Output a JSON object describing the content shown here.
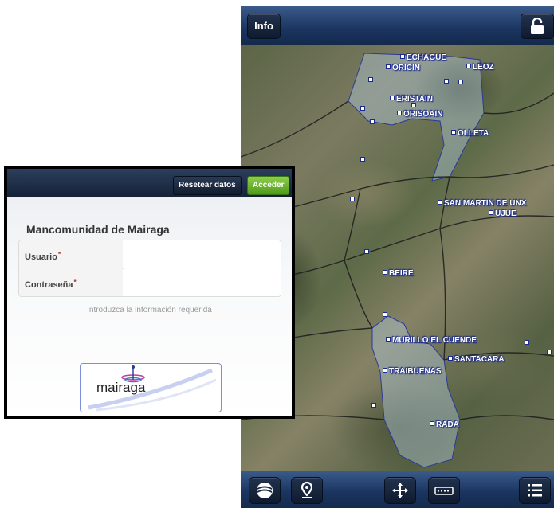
{
  "map_app": {
    "info_label": "Info",
    "lock_icon": "unlock-icon",
    "towns": [
      {
        "name": "ECHAGUE"
      },
      {
        "name": "ORICIN"
      },
      {
        "name": "LEOZ"
      },
      {
        "name": "ERISTAIN"
      },
      {
        "name": "ORISOAIN"
      },
      {
        "name": "OLLETA"
      },
      {
        "name": "SAN MARTIN DE UNX"
      },
      {
        "name": "UJUE"
      },
      {
        "name": "BEIRE"
      },
      {
        "name": "MURILLO EL CUENDE"
      },
      {
        "name": "SANTACARA"
      },
      {
        "name": "TRAIBUENAS"
      },
      {
        "name": "RADA"
      }
    ],
    "bottom_icons": [
      "layers-globe-icon",
      "location-pin-icon",
      "move-arrows-icon",
      "keyboard-icon",
      "list-menu-icon"
    ],
    "accent_color": "#1b3560",
    "label_outline_color": "#1a2a8a"
  },
  "login": {
    "reset_label": "Resetear datos",
    "access_label": "Acceder",
    "org_title": "Mancomunidad de Mairaga",
    "fields": [
      {
        "label": "Usuario",
        "required_mark": "*",
        "value": "",
        "placeholder": ""
      },
      {
        "label": "Contraseña",
        "required_mark": "*",
        "value": "",
        "placeholder": ""
      }
    ],
    "hint": "Introduzca la información requerida",
    "logo_text": "mairaga",
    "access_color": "#6cb52c"
  }
}
